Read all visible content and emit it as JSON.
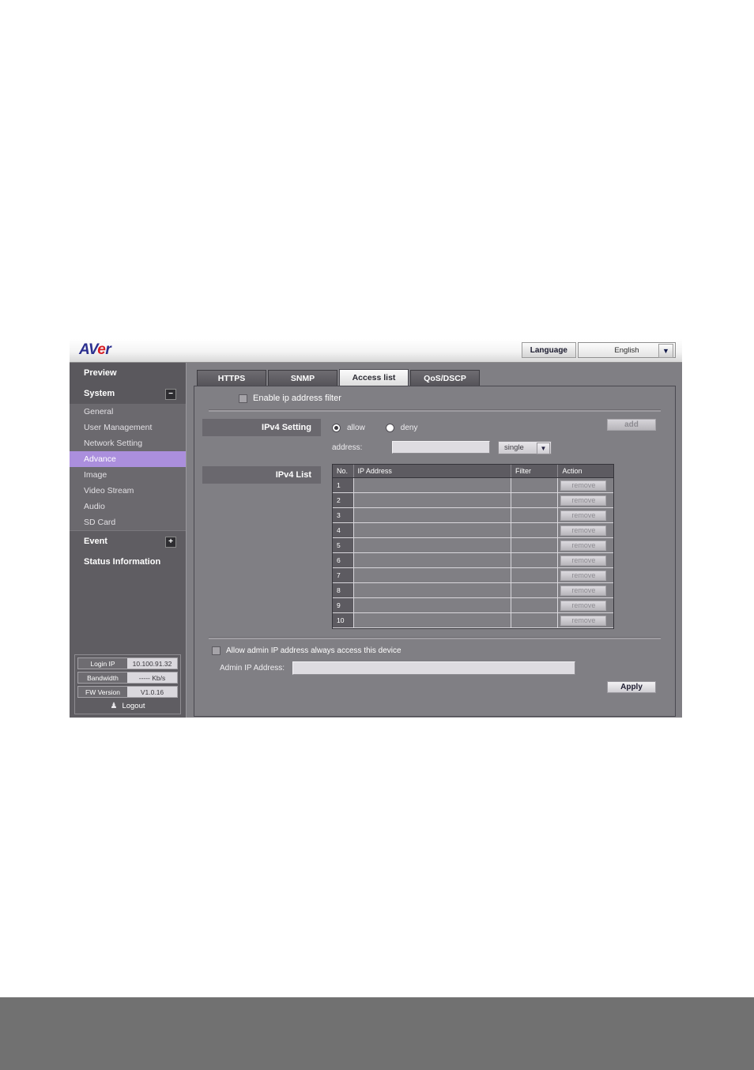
{
  "header": {
    "logo_a": "A",
    "logo_v": "V",
    "logo_e": "e",
    "logo_r": "r",
    "language_label": "Language",
    "language_value": "English",
    "caret_icon": "▼"
  },
  "sidebar": {
    "groups": [
      {
        "label": "Preview",
        "toggle": ""
      },
      {
        "label": "System",
        "toggle": "−"
      }
    ],
    "sub_items": [
      {
        "label": "General",
        "active": false
      },
      {
        "label": "User Management",
        "active": false
      },
      {
        "label": "Network Setting",
        "active": false
      },
      {
        "label": "Advance",
        "active": true
      },
      {
        "label": "Image",
        "active": false
      },
      {
        "label": "Video Stream",
        "active": false
      },
      {
        "label": "Audio",
        "active": false
      },
      {
        "label": "SD Card",
        "active": false
      }
    ],
    "event_label": "Event",
    "event_toggle": "+",
    "status_information_label": "Status Information",
    "status": [
      {
        "key": "Login IP",
        "value": "10.100.91.32"
      },
      {
        "key": "Bandwidth",
        "value": "----- Kb/s"
      },
      {
        "key": "FW Version",
        "value": "V1.0.16"
      }
    ],
    "logout_icon": "♟",
    "logout_label": "Logout"
  },
  "tabs": [
    {
      "label": "HTTPS",
      "active": false
    },
    {
      "label": "SNMP",
      "active": false
    },
    {
      "label": "Access list",
      "active": true
    },
    {
      "label": "QoS/DSCP",
      "active": false
    }
  ],
  "main": {
    "enable_filter_label": "Enable ip address filter",
    "enable_filter_checked": false,
    "ipv4_setting_label": "IPv4 Setting",
    "radio_allow_label": "allow",
    "radio_deny_label": "deny",
    "radio_selected": "allow",
    "address_label": "address:",
    "address_value": "",
    "range_select_value": "single",
    "range_caret": "▼",
    "add_button_label": "add",
    "ipv4_list_label": "IPv4 List",
    "table": {
      "columns": [
        "No.",
        "IP Address",
        "Filter",
        "Action"
      ],
      "rows": [
        {
          "no": "1",
          "ip": "",
          "filter": "",
          "action": "remove"
        },
        {
          "no": "2",
          "ip": "",
          "filter": "",
          "action": "remove"
        },
        {
          "no": "3",
          "ip": "",
          "filter": "",
          "action": "remove"
        },
        {
          "no": "4",
          "ip": "",
          "filter": "",
          "action": "remove"
        },
        {
          "no": "5",
          "ip": "",
          "filter": "",
          "action": "remove"
        },
        {
          "no": "6",
          "ip": "",
          "filter": "",
          "action": "remove"
        },
        {
          "no": "7",
          "ip": "",
          "filter": "",
          "action": "remove"
        },
        {
          "no": "8",
          "ip": "",
          "filter": "",
          "action": "remove"
        },
        {
          "no": "9",
          "ip": "",
          "filter": "",
          "action": "remove"
        },
        {
          "no": "10",
          "ip": "",
          "filter": "",
          "action": "remove"
        }
      ]
    },
    "allow_admin_label": "Allow admin IP address always access this device",
    "allow_admin_checked": false,
    "admin_ip_label": "Admin IP Address:",
    "admin_ip_value": "",
    "apply_button_label": "Apply"
  }
}
